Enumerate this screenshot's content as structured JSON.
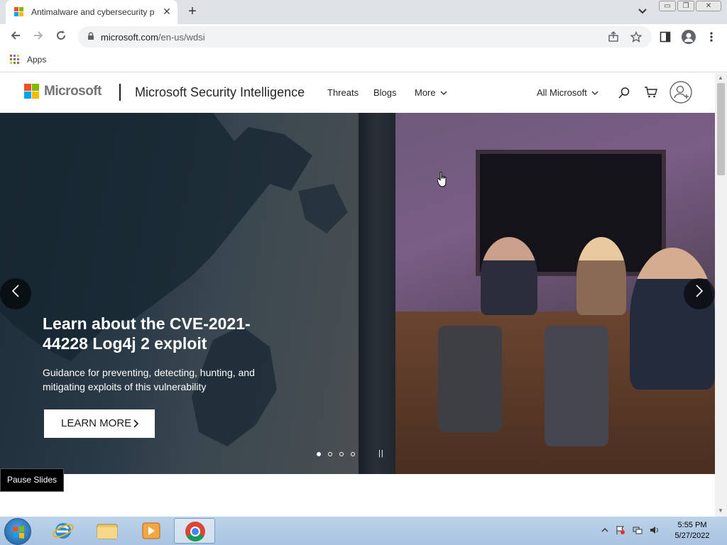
{
  "browser": {
    "tab_title": "Antimalware and cybersecurity p",
    "tab_close": "✕",
    "new_tab": "+",
    "address_domain": "microsoft.com",
    "address_path": "/en-us/wdsi",
    "window_controls": {
      "minimize": "▭",
      "restore": "❐",
      "close": "✕"
    },
    "bookmarks": {
      "apps_label": "Apps"
    }
  },
  "site": {
    "brand": "Microsoft",
    "title": "Microsoft Security Intelligence",
    "nav": {
      "threats": "Threats",
      "blogs": "Blogs",
      "more": "More",
      "all_microsoft": "All Microsoft"
    }
  },
  "hero": {
    "title": "Learn about the CVE-2021-44228 Log4j 2 exploit",
    "subtitle": "Guidance for preventing, detecting, hunting, and mitigating exploits of this vulnerability",
    "cta_label": "LEARN MORE",
    "pause_label": "||",
    "slide_count": 4,
    "active_slide": 1,
    "pause_tooltip": "Pause Slides"
  },
  "taskbar": {
    "time": "5:55 PM",
    "date": "5/27/2022"
  },
  "colors": {
    "ms_red": "#f25022",
    "ms_green": "#7fba00",
    "ms_blue": "#00a4ef",
    "ms_yellow": "#ffb900"
  }
}
